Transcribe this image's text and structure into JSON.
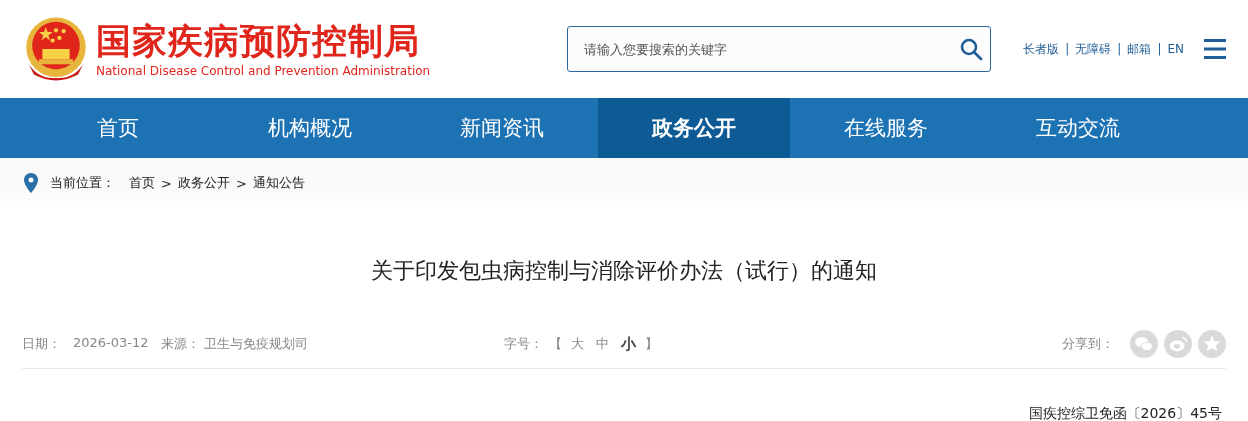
{
  "header": {
    "title": "国家疾病预防控制局",
    "subtitle": "National Disease Control and Prevention Administration"
  },
  "search": {
    "placeholder": "请输入您要搜索的关键字"
  },
  "top_links": [
    "长者版",
    "无障碍",
    "邮箱",
    "EN"
  ],
  "top_link_separator": "|",
  "nav": [
    {
      "label": "首页",
      "selected": false
    },
    {
      "label": "机构概况",
      "selected": false
    },
    {
      "label": "新闻资讯",
      "selected": false
    },
    {
      "label": "政务公开",
      "selected": true
    },
    {
      "label": "在线服务",
      "selected": false
    },
    {
      "label": "互动交流",
      "selected": false
    }
  ],
  "breadcrumb": {
    "label": "当前位置：",
    "items": [
      "首页",
      "政务公开",
      "通知公告"
    ],
    "separator": ">"
  },
  "article": {
    "title": "关于印发包虫病控制与消除评价办法（试行）的通知",
    "date_label": "日期：",
    "date": "2026-03-12",
    "source_label": "来源：",
    "source": "卫生与免疫规划司",
    "font_size_label": "字号：",
    "bracket_open": "【",
    "bracket_close": "】",
    "font_sizes": [
      {
        "label": "大",
        "selected": false
      },
      {
        "label": "中",
        "selected": false
      },
      {
        "label": "小",
        "selected": true
      }
    ],
    "share_label": "分享到：",
    "document_number": "国疾控综卫免函〔2026〕45号"
  }
}
